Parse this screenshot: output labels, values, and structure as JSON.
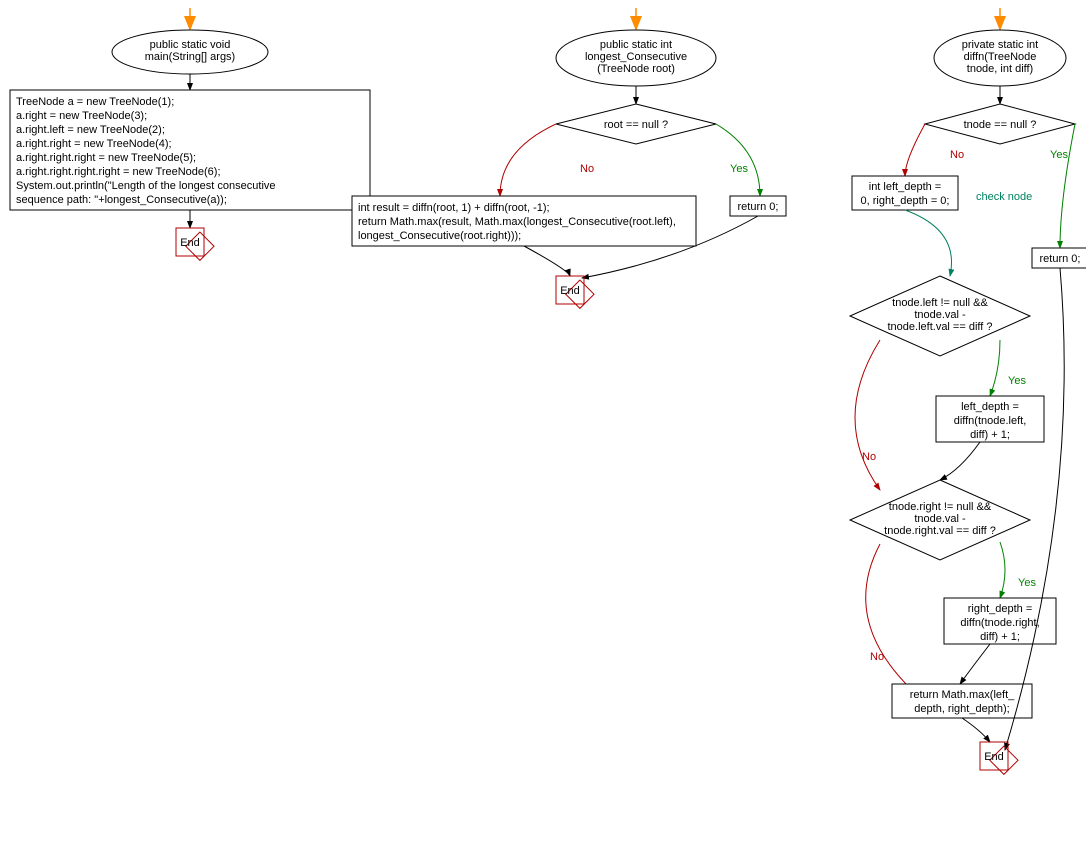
{
  "flowchart1": {
    "start": {
      "line1": "public static void",
      "line2": "main(String[] args)"
    },
    "body": [
      "TreeNode a = new TreeNode(1);",
      "a.right = new TreeNode(3);",
      "a.right.left = new TreeNode(2);",
      "a.right.right = new TreeNode(4);",
      "a.right.right.right = new TreeNode(5);",
      "a.right.right.right.right = new TreeNode(6);",
      "System.out.println(\"Length of the longest consecutive",
      "sequence path: \"+longest_Consecutive(a));"
    ],
    "end": "End"
  },
  "flowchart2": {
    "start": {
      "line1": "public static int",
      "line2": "longest_Consecutive",
      "line3": "(TreeNode root)"
    },
    "decision": "root == null ?",
    "no": "No",
    "yes": "Yes",
    "left_body": [
      "int result = diffn(root, 1) + diffn(root, -1);",
      "return Math.max(result, Math.max(longest_Consecutive(root.left),",
      "longest_Consecutive(root.right)));"
    ],
    "right_body": "return 0;",
    "end": "End"
  },
  "flowchart3": {
    "start": {
      "line1": "private static int",
      "line2": "diffn(TreeNode",
      "line3": "tnode, int diff)"
    },
    "decision1": "tnode == null ?",
    "no": "No",
    "yes": "Yes",
    "check": "check node",
    "init": [
      "int left_depth =",
      "0, right_depth = 0;"
    ],
    "return0": "return 0;",
    "decision2": [
      "tnode.left != null &&",
      "tnode.val -",
      "tnode.left.val == diff ?"
    ],
    "left_assign": [
      "left_depth =",
      "diffn(tnode.left,",
      "diff) + 1;"
    ],
    "decision3": [
      "tnode.right != null &&",
      "tnode.val -",
      "tnode.right.val == diff ?"
    ],
    "right_assign": [
      "right_depth =",
      "diffn(tnode.right,",
      "diff) + 1;"
    ],
    "return_max": [
      "return Math.max(left_",
      "depth, right_depth);"
    ],
    "end": "End"
  }
}
